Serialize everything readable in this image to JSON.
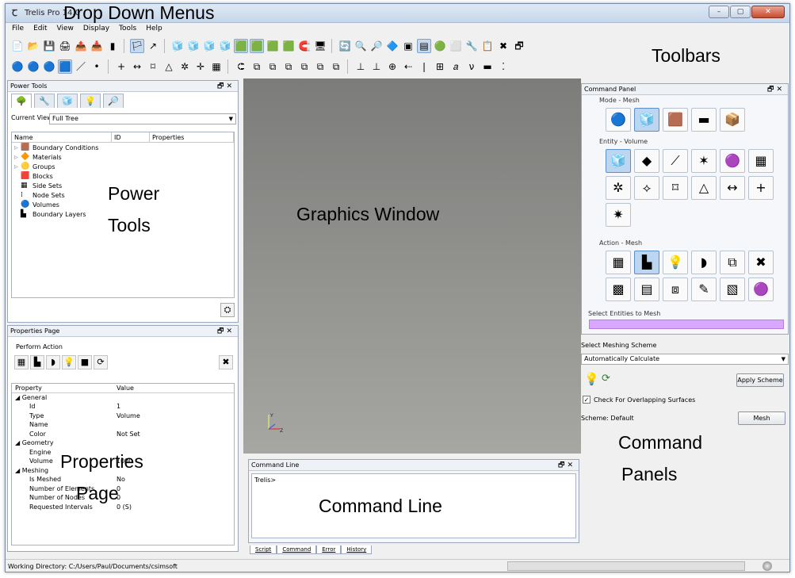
{
  "window": {
    "title": "Trelis Pro 14.0",
    "app_icon": "trelis-icon"
  },
  "menu": [
    "File",
    "Edit",
    "View",
    "Display",
    "Tools",
    "Help"
  ],
  "labels": {
    "drop_down_menus": "Drop Down Menus",
    "toolbars": "Toolbars",
    "power_tools": "Power Tools",
    "graphics_window": "Graphics Window",
    "properties_page": "Properties Page",
    "command_line": "Command Line",
    "command_panels": "Command Panels"
  },
  "toolbar1": [
    "📄",
    "📂",
    "💾",
    "🖨",
    "📤",
    "📥",
    "▮",
    "🏳",
    "↗",
    "🧊",
    "🧊",
    "🧊",
    "🧊",
    "🟩",
    "🟩",
    "🟩",
    "🟩",
    "🧲",
    "🖥",
    "🔄",
    "🔍",
    "🔎",
    "🔷",
    "▣",
    "▤",
    "🟢",
    "⬜",
    "🔧",
    "📋",
    "✖",
    "🗗"
  ],
  "toolbar2": [
    "🔵",
    "🔵",
    "🔵",
    "🟦",
    "／",
    "•",
    "+",
    "↔",
    "⌑",
    "△",
    "✲",
    "✛",
    "▦",
    "⮈",
    "⧉",
    "⧉",
    "⧉",
    "⧉",
    "⧉",
    "⧉",
    "⊥",
    "⊥",
    "⊕",
    "⇠",
    "❘",
    "⊞",
    "𝑎",
    "ν",
    "▬",
    "⁚"
  ],
  "power_tools": {
    "header": "Power Tools",
    "tabs": [
      "🌳",
      "🔧",
      "🧊",
      "💡",
      "🔎"
    ],
    "current_view_label": "Current View",
    "current_view_value": "Full Tree",
    "columns": [
      "Name",
      "ID",
      "Properties"
    ],
    "items": [
      {
        "label": "Boundary Conditions",
        "icon": "🟫",
        "exp": "▷"
      },
      {
        "label": "Materials",
        "icon": "🔶",
        "exp": "▷"
      },
      {
        "label": "Groups",
        "icon": "🟡",
        "exp": "▷"
      },
      {
        "label": "Blocks",
        "icon": "🟥",
        "exp": ""
      },
      {
        "label": "Side Sets",
        "icon": "▦",
        "exp": ""
      },
      {
        "label": "Node Sets",
        "icon": "⁞",
        "exp": ""
      },
      {
        "label": "Volumes",
        "icon": "🔵",
        "exp": ""
      },
      {
        "label": "Boundary Layers",
        "icon": "▙",
        "exp": ""
      }
    ]
  },
  "properties": {
    "header": "Properties Page",
    "perform_action": "Perform Action",
    "columns": [
      "Property",
      "Value"
    ],
    "rows": [
      {
        "k": "◢ General",
        "v": ""
      },
      {
        "k": "Id",
        "v": "1"
      },
      {
        "k": "Type",
        "v": "Volume"
      },
      {
        "k": "Name",
        "v": ""
      },
      {
        "k": "Color",
        "v": "Not Set"
      },
      {
        "k": "◢ Geometry",
        "v": ""
      },
      {
        "k": "Engine",
        "v": ""
      },
      {
        "k": "Volume",
        "v": "1000"
      },
      {
        "k": "◢ Meshing",
        "v": ""
      },
      {
        "k": "Is Meshed",
        "v": "No"
      },
      {
        "k": "Number of Elements",
        "v": "0"
      },
      {
        "k": "Number of Nodes",
        "v": "0"
      },
      {
        "k": "Requested Intervals",
        "v": "0 (S)"
      }
    ]
  },
  "command_panel": {
    "header": "Command Panel",
    "mode_label": "Mode - Mesh",
    "entity_label": "Entity - Volume",
    "action_label": "Action - Mesh",
    "select_entities_label": "Select Entities to Mesh",
    "scheme_label": "Select Meshing Scheme",
    "scheme_value": "Automatically Calculate",
    "apply_scheme": "Apply Scheme",
    "check_overlap": "Check For Overlapping Surfaces",
    "scheme_default": "Scheme: Default",
    "mesh_button": "Mesh"
  },
  "command_line": {
    "header": "Command Line",
    "prompt": "Trelis>",
    "tabs": [
      "Script",
      "Command",
      "Error",
      "History"
    ]
  },
  "status": {
    "working_dir": "Working Directory: C:/Users/Paul/Documents/csimsoft"
  }
}
